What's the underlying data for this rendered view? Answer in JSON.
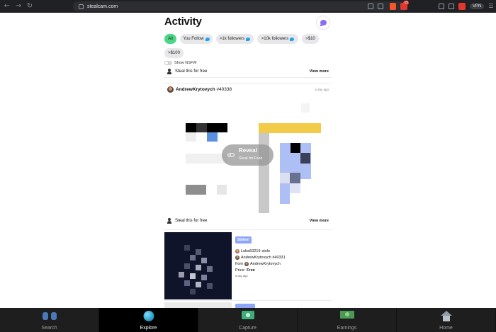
{
  "browser": {
    "url": "stealcam.com",
    "extension_badge": "15",
    "vpn_label": "VPN"
  },
  "header": {
    "title": "Activity",
    "chat_icon": "chat-bubble-icon"
  },
  "filters": [
    {
      "label": "All",
      "active": true
    },
    {
      "label": "You Follow",
      "twitter": true
    },
    {
      "label": ">1k followers",
      "twitter": true
    },
    {
      "label": ">10k followers",
      "twitter": true
    },
    {
      "label": ">$10"
    },
    {
      "label": ">$100"
    }
  ],
  "nsfw": {
    "label": "Show NSFW",
    "enabled": false
  },
  "feed": {
    "steal_label": "Steal this for free",
    "view_more": "View more",
    "post": {
      "author": "AndrewKrytovych",
      "number": "#40338",
      "ago": "a day ago",
      "reveal_title": "Reveal",
      "reveal_sub": "Steal for Free"
    },
    "stolen": {
      "badge": "Stolen!",
      "stealer": "Luba53219",
      "stole_word": "stole",
      "item": "AndrewKrytovych #40331",
      "from_word": "from",
      "from_user": "AndrewKrytovych",
      "price_label": "Price:",
      "price_value": "Free",
      "ago": "a day ago"
    }
  },
  "tabs": [
    {
      "label": "Search",
      "icon": "binoculars-icon",
      "active": false
    },
    {
      "label": "Explore",
      "icon": "globe-icon",
      "active": true
    },
    {
      "label": "Capture",
      "icon": "camera-icon",
      "active": false
    },
    {
      "label": "Earnings",
      "icon": "money-icon",
      "active": false
    },
    {
      "label": "Home",
      "icon": "house-icon",
      "active": false
    }
  ],
  "colors": {
    "accent_green": "#4cd787",
    "stolen_badge": "#8ea6f7",
    "tabbar": "#1e1e1e",
    "twitter_blue": "#1da1f2"
  }
}
